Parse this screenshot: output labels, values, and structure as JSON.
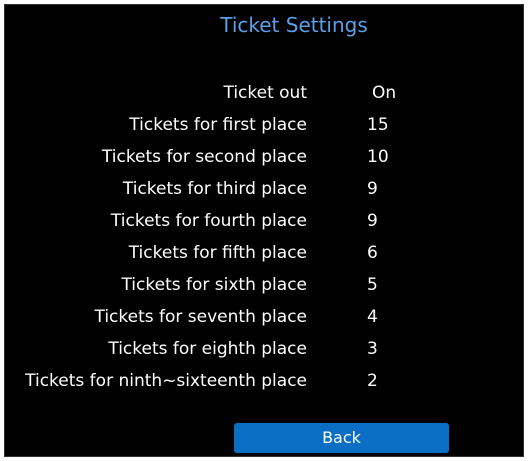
{
  "title": "Ticket Settings",
  "settings": [
    {
      "label": "Ticket out",
      "value": "On"
    },
    {
      "label": "Tickets for first place",
      "value": "15"
    },
    {
      "label": "Tickets for second place",
      "value": "10"
    },
    {
      "label": "Tickets for third place",
      "value": "9"
    },
    {
      "label": "Tickets for fourth place",
      "value": "9"
    },
    {
      "label": "Tickets for fifth place",
      "value": "6"
    },
    {
      "label": "Tickets for sixth place",
      "value": "5"
    },
    {
      "label": "Tickets for seventh place",
      "value": "4"
    },
    {
      "label": "Tickets for eighth place",
      "value": "3"
    },
    {
      "label": "Tickets for ninth~sixteenth place",
      "value": "2"
    }
  ],
  "back_label": "Back",
  "colors": {
    "background": "#000000",
    "title": "#5aa0e8",
    "text": "#ffffff",
    "button": "#0a6fc4"
  }
}
